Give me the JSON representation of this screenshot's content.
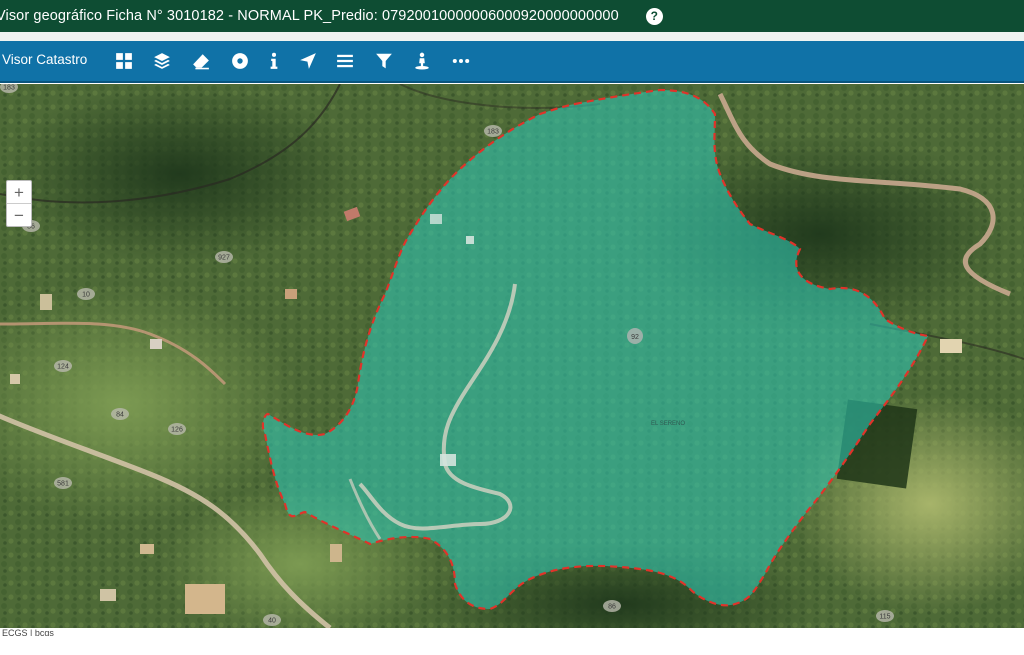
{
  "title_bar": {
    "title": "Visor geográfico Ficha N° 3010182 - NORMAL PK_Predio: 07920010000006000920000000000",
    "help_label": "?"
  },
  "toolbar": {
    "app_name": "Visor Catastro",
    "tools": [
      {
        "icon": "grid-icon"
      },
      {
        "icon": "layers-icon"
      },
      {
        "icon": "eraser-icon"
      },
      {
        "icon": "target-icon"
      },
      {
        "icon": "info-icon"
      },
      {
        "icon": "location-arrow-icon"
      },
      {
        "icon": "menu-icon"
      },
      {
        "icon": "filter-icon"
      },
      {
        "icon": "street-view-icon"
      },
      {
        "icon": "more-icon"
      }
    ]
  },
  "map": {
    "zoom_in": "+",
    "zoom_out": "−",
    "attribution": "ECGS | bcqs",
    "parcel_label": "92",
    "place_label": "EL SERENO",
    "parcel_labels": [
      "183",
      "183",
      "927",
      "124",
      "126",
      "581",
      "86",
      "84",
      "86",
      "40",
      "115",
      "10"
    ],
    "colors": {
      "parcel_fill": "#2fc7b3",
      "parcel_border": "#e0332a",
      "road": "#c9b49a"
    }
  }
}
